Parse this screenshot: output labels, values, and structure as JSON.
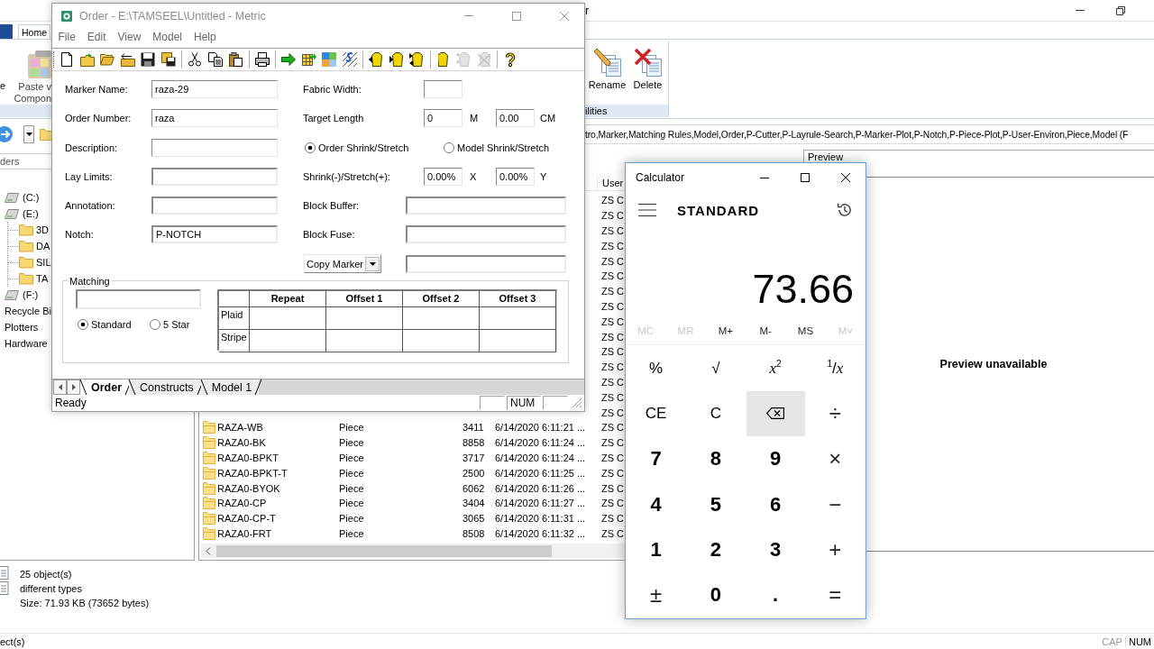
{
  "explorer": {
    "title": "r",
    "ribbon_tabs": [
      {
        "label": "Home",
        "selected": true
      }
    ],
    "ribbon": {
      "cut_label": "e",
      "paste_button": [
        "Paste v",
        "Compon"
      ],
      "buttons": [
        {
          "kind": "rename",
          "label": "Rename"
        },
        {
          "kind": "delete",
          "label": "Delete"
        }
      ],
      "group_label": "ilities"
    },
    "address_bar": {
      "path": "tro,Marker,Matching Rules,Model,Order,P-Cutter,P-Layrule-Search,P-Marker-Plot,P-Notch,P-Piece-Plot,P-User-Environ,Piece,Model (F"
    },
    "folders": {
      "header": "ders",
      "tree": [
        {
          "kind": "drive",
          "label": "(C:)"
        },
        {
          "kind": "drive",
          "label": "(E:)",
          "children": [
            {
              "kind": "folder",
              "label": "3D"
            },
            {
              "kind": "folder",
              "label": "DA"
            },
            {
              "kind": "folder",
              "label": "SIL"
            },
            {
              "kind": "folder",
              "label": "TA"
            }
          ]
        },
        {
          "kind": "drive",
          "label": "(F:)"
        },
        {
          "kind": "plain",
          "label": "Recycle Bi"
        },
        {
          "kind": "plain",
          "label": "Plotters"
        },
        {
          "kind": "plain",
          "label": "Hardware"
        }
      ]
    },
    "file_list": {
      "column_header": "User",
      "rows": [
        {
          "user": "ZS C"
        },
        {
          "user": "ZS C"
        },
        {
          "user": "ZS C"
        },
        {
          "user": "ZS C"
        },
        {
          "user": "ZS C"
        },
        {
          "user": "ZS C"
        },
        {
          "user": "ZS C"
        },
        {
          "user": "ZS C"
        },
        {
          "user": "ZS C"
        },
        {
          "user": "ZS C"
        },
        {
          "user": "ZS C"
        },
        {
          "user": "ZS C"
        },
        {
          "user": "ZS C"
        },
        {
          "user": "ZS C"
        },
        {
          "user": "ZS C"
        },
        {
          "name": "RAZA-WB",
          "type": "Piece",
          "size": "3411",
          "date": "6/14/2020 6:11:21 ...",
          "user": "ZS C"
        },
        {
          "name": "RAZA0-BK",
          "type": "Piece",
          "size": "8858",
          "date": "6/14/2020 6:11:24 ...",
          "user": "ZS C"
        },
        {
          "name": "RAZA0-BPKT",
          "type": "Piece",
          "size": "3717",
          "date": "6/14/2020 6:11:24 ...",
          "user": "ZS C"
        },
        {
          "name": "RAZA0-BPKT-T",
          "type": "Piece",
          "size": "2500",
          "date": "6/14/2020 6:11:25 ...",
          "user": "ZS C"
        },
        {
          "name": "RAZA0-BYOK",
          "type": "Piece",
          "size": "6062",
          "date": "6/14/2020 6:11:26 ...",
          "user": "ZS C"
        },
        {
          "name": "RAZA0-CP",
          "type": "Piece",
          "size": "3404",
          "date": "6/14/2020 6:11:27 ...",
          "user": "ZS C"
        },
        {
          "name": "RAZA0-CP-T",
          "type": "Piece",
          "size": "3065",
          "date": "6/14/2020 6:11:31 ...",
          "user": "ZS C"
        },
        {
          "name": "RAZA0-FRT",
          "type": "Piece",
          "size": "8508",
          "date": "6/14/2020 6:11:32 ...",
          "user": "ZS C"
        }
      ]
    },
    "preview": {
      "header": "Preview",
      "message": "Preview unavailable"
    },
    "details": [
      "25 object(s)",
      "different types",
      "Size: 71.93 KB (73652 bytes)"
    ],
    "status_bar": {
      "text": "ect(s)",
      "indicators": [
        {
          "label": "CAP",
          "on": false
        },
        {
          "label": "NUM",
          "on": true
        }
      ]
    }
  },
  "order_window": {
    "title": "Order - E:\\TAMSEEL\\Untitled - Metric",
    "menu": [
      "File",
      "Edit",
      "View",
      "Model",
      "Help"
    ],
    "toolbar": [
      [
        {
          "kind": "new",
          "disabled": false
        },
        {
          "kind": "open",
          "disabled": false
        },
        {
          "kind": "openfolder",
          "disabled": false
        },
        {
          "kind": "folderback",
          "disabled": false
        },
        {
          "kind": "save",
          "disabled": false
        },
        {
          "kind": "saveall",
          "disabled": false
        }
      ],
      [
        {
          "kind": "cut",
          "disabled": false
        },
        {
          "kind": "copy",
          "disabled": false
        },
        {
          "kind": "paste",
          "disabled": false
        }
      ],
      [
        {
          "kind": "print",
          "disabled": false
        }
      ],
      [
        {
          "kind": "arrow",
          "disabled": false
        },
        {
          "kind": "grid",
          "disabled": false
        },
        {
          "kind": "tiles",
          "disabled": false
        },
        {
          "kind": "stripes",
          "disabled": false
        }
      ],
      [
        {
          "kind": "garmentleft",
          "disabled": false
        },
        {
          "kind": "garmentright",
          "disabled": false
        },
        {
          "kind": "garmentboth",
          "disabled": false
        }
      ],
      [
        {
          "kind": "garment",
          "disabled": false
        },
        {
          "kind": "garmentup",
          "disabled": true
        },
        {
          "kind": "garmentx",
          "disabled": true
        }
      ],
      [
        {
          "kind": "help",
          "disabled": false
        }
      ]
    ],
    "fields": [
      {
        "label": "Marker Name:",
        "value": "raza-29",
        "kind": "flat"
      },
      {
        "label": "Order Number:",
        "value": "raza",
        "kind": "flat"
      },
      {
        "label": "Description:",
        "kind": "flat"
      },
      {
        "label": "Lay Limits:",
        "kind": "sunken"
      },
      {
        "label": "Annotation:",
        "kind": "sunken"
      },
      {
        "label": "Notch:",
        "value": "P-NOTCH",
        "kind": "sunken"
      }
    ],
    "fabric_width": {
      "label": "Fabric Width:"
    },
    "target_length": {
      "label": "Target Length",
      "fields": [
        {
          "value": "0",
          "unit": "M"
        },
        {
          "value": "0.00",
          "unit": "CM"
        }
      ]
    },
    "shrink_mode": [
      {
        "label": "Order Shrink/Stretch",
        "selected": true
      },
      {
        "label": "Model Shrink/Stretch",
        "selected": false
      }
    ],
    "shrink_stretch": {
      "label": "Shrink(-)/Stretch(+):",
      "fields": [
        {
          "value": "0.00%",
          "unit": "X"
        },
        {
          "value": "0.00%",
          "unit": "Y"
        }
      ]
    },
    "block_buffer": {
      "label": "Block Buffer:"
    },
    "block_fuse": {
      "label": "Block Fuse:"
    },
    "copy_marker": {
      "dropdown": "Copy Marker"
    },
    "matching": {
      "title": "Matching",
      "options": [
        {
          "label": "Standard",
          "selected": true
        },
        {
          "label": "5 Star",
          "selected": false
        }
      ],
      "table": {
        "columns": [
          "Repeat",
          "Offset 1",
          "Offset 2",
          "Offset 3"
        ],
        "rows": [
          "Plaid",
          "Stripe"
        ]
      }
    },
    "tabs": [
      {
        "label": "Order",
        "selected": true
      },
      {
        "label": "Constructs",
        "selected": false
      },
      {
        "label": "Model 1",
        "selected": false
      }
    ],
    "status_bar": {
      "text": "Ready",
      "indicator": "NUM"
    }
  },
  "calculator": {
    "title": "Calculator",
    "mode": "STANDARD",
    "display": "73.66",
    "memory": [
      {
        "label": "MC",
        "disabled": true
      },
      {
        "label": "MR",
        "disabled": true
      },
      {
        "label": "M+",
        "disabled": false
      },
      {
        "label": "M-",
        "disabled": false
      },
      {
        "label": "MS",
        "disabled": false
      },
      {
        "label": "M˅",
        "disabled": true
      }
    ],
    "keys": [
      [
        {
          "label": "%",
          "kind": "fn",
          "hovered": false
        },
        {
          "label": "√",
          "kind": "fn",
          "hovered": false
        },
        {
          "label": "*x*$^{2}$",
          "kind": "fn",
          "hovered": false
        },
        {
          "label": "$^{1}$/*x*",
          "kind": "fn",
          "hovered": false
        }
      ],
      [
        {
          "label": "CE",
          "kind": "fn",
          "hovered": false
        },
        {
          "label": "C",
          "kind": "fn",
          "hovered": false
        },
        {
          "kind": "backspace",
          "hovered": true
        },
        {
          "label": "÷",
          "kind": "op",
          "hovered": false
        }
      ],
      [
        {
          "label": "7",
          "kind": "digit",
          "hovered": false
        },
        {
          "label": "8",
          "kind": "digit",
          "hovered": false
        },
        {
          "label": "9",
          "kind": "digit",
          "hovered": false
        },
        {
          "label": "×",
          "kind": "op",
          "hovered": false
        }
      ],
      [
        {
          "label": "4",
          "kind": "digit",
          "hovered": false
        },
        {
          "label": "5",
          "kind": "digit",
          "hovered": false
        },
        {
          "label": "6",
          "kind": "digit",
          "hovered": false
        },
        {
          "label": "−",
          "kind": "op",
          "hovered": false
        }
      ],
      [
        {
          "label": "1",
          "kind": "digit",
          "hovered": false
        },
        {
          "label": "2",
          "kind": "digit",
          "hovered": false
        },
        {
          "label": "3",
          "kind": "digit",
          "hovered": false
        },
        {
          "label": "+",
          "kind": "op",
          "hovered": false
        }
      ],
      [
        {
          "label": "±",
          "kind": "op",
          "hovered": false
        },
        {
          "label": "0",
          "kind": "digit",
          "hovered": false
        },
        {
          "label": ".",
          "kind": "digit",
          "hovered": false
        },
        {
          "label": "=",
          "kind": "op",
          "hovered": false
        }
      ]
    ]
  }
}
